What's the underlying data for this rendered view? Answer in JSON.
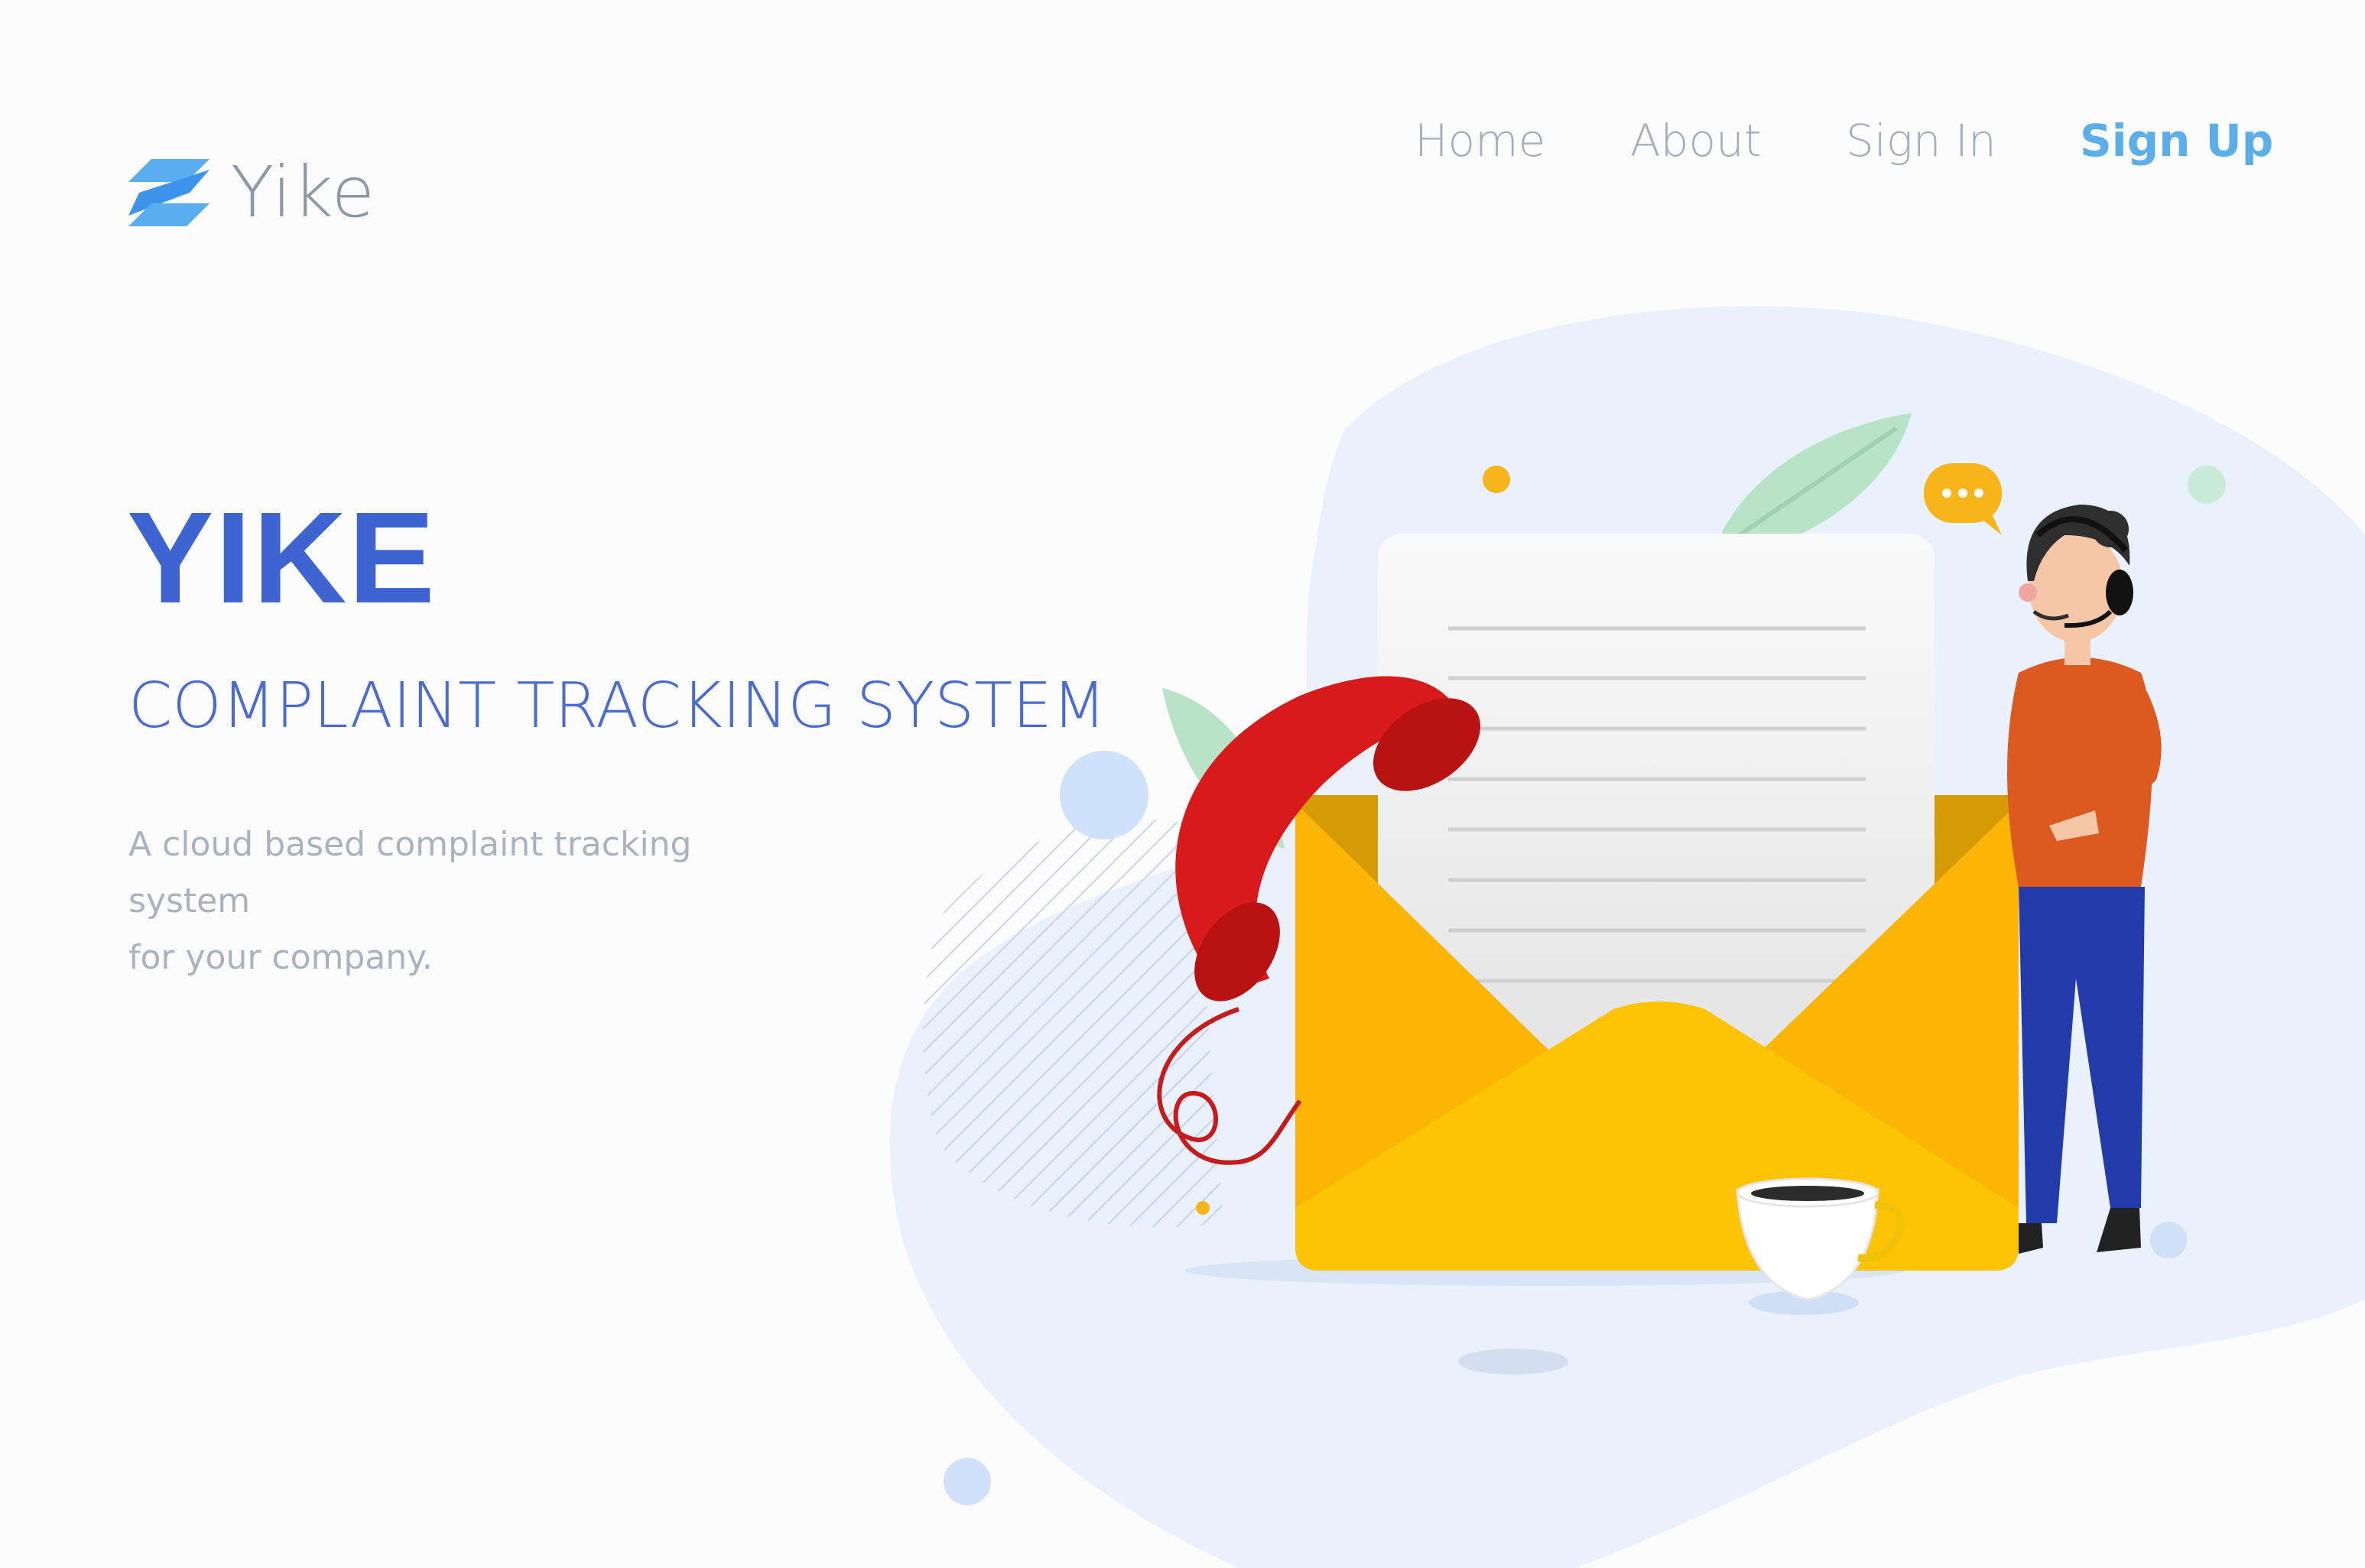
{
  "brand": {
    "name": "Yike",
    "accent": "#3d64d1",
    "logo_color": "#4aa3f0"
  },
  "nav": {
    "items": [
      {
        "label": "Home"
      },
      {
        "label": "About"
      },
      {
        "label": "Sign In"
      },
      {
        "label": "Sign Up",
        "active": true,
        "color": "#5aaee9"
      }
    ]
  },
  "hero": {
    "title": "YIKE",
    "subtitle": "COMPLAINT TRACKING SYSTEM",
    "description_line1": "A cloud based complaint tracking system",
    "description_line2": "for your company."
  },
  "illustration": {
    "icons": [
      "envelope-icon",
      "letter-icon",
      "telephone-icon",
      "support-agent-icon",
      "chat-bubble-icon",
      "coffee-cup-icon",
      "leaf-icon"
    ]
  }
}
